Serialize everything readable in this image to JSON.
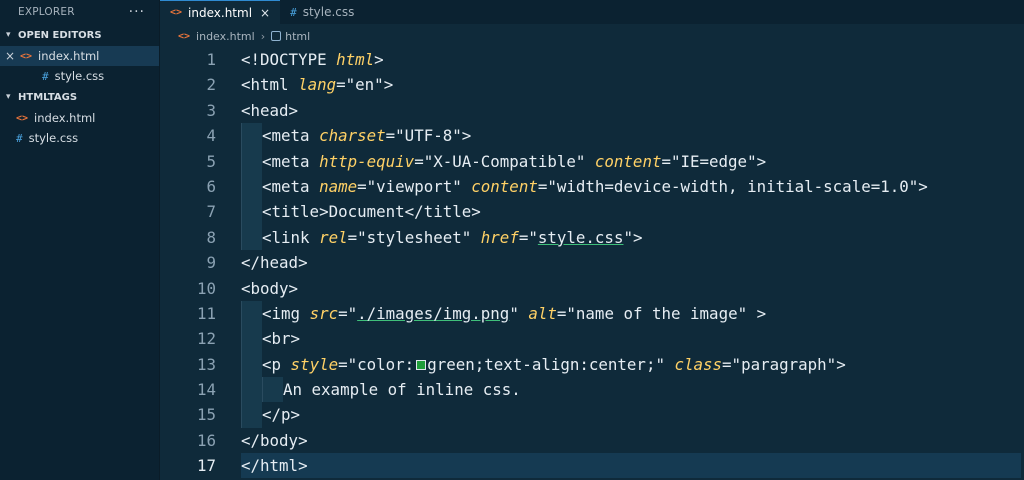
{
  "sidebar": {
    "title": "EXPLORER",
    "more": "···",
    "sections": [
      {
        "label": "OPEN EDITORS"
      },
      {
        "label": "HTMLTAGS"
      }
    ],
    "open_editors": [
      {
        "name": "index.html",
        "icon": "<>"
      },
      {
        "name": "style.css",
        "icon": "#"
      }
    ],
    "files": [
      {
        "name": "index.html",
        "icon": "<>"
      },
      {
        "name": "style.css",
        "icon": "#"
      }
    ]
  },
  "tabs": [
    {
      "label": "index.html",
      "icon": "<>",
      "close": "×"
    },
    {
      "label": "style.css",
      "icon": "#"
    }
  ],
  "breadcrumb": {
    "file": "index.html",
    "item": "html",
    "file_icon": "<>"
  },
  "editor": {
    "line_numbers": [
      "1",
      "2",
      "3",
      "4",
      "5",
      "6",
      "7",
      "8",
      "9",
      "10",
      "11",
      "12",
      "13",
      "14",
      "15",
      "16",
      "17"
    ],
    "code": {
      "l1": {
        "open": "<!DOCTYPE ",
        "kw": "html",
        "close": ">"
      },
      "l2": {
        "open": "<html ",
        "a1": "lang",
        "v1": "=\"en\"",
        "close": ">"
      },
      "l3": {
        "text": "<head>"
      },
      "l4": {
        "open": "<meta ",
        "a1": "charset",
        "v1": "=\"UTF-8\"",
        "close": ">"
      },
      "l5": {
        "open": "<meta ",
        "a1": "http-equiv",
        "v1": "=\"X-UA-Compatible\" ",
        "a2": "content",
        "v2": "=\"IE=edge\"",
        "close": ">"
      },
      "l6": {
        "open": "<meta ",
        "a1": "name",
        "v1": "=\"viewport\" ",
        "a2": "content",
        "v2": "=\"width=device-width, initial-scale=1.0\"",
        "close": ">"
      },
      "l7": {
        "text": "<title>Document</title>"
      },
      "l8": {
        "open": "<link ",
        "a1": "rel",
        "v1": "=\"stylesheet\" ",
        "a2": "href",
        "v2a": "=\"",
        "link": "style.css",
        "v2b": "\"",
        "close": ">"
      },
      "l9": {
        "text": "</head>"
      },
      "l10": {
        "text": "<body>"
      },
      "l11": {
        "open": "<img ",
        "a1": "src",
        "v1a": "=\"",
        "link": "./images/img.png",
        "v1b": "\" ",
        "a2": "alt",
        "v2": "=\"name of the image\" ",
        "close": ">"
      },
      "l12": {
        "text": "<br>"
      },
      "l13": {
        "open": "<p ",
        "a1": "style",
        "v1a": "=\"color:",
        "v1b": "green;text-align:center;\" ",
        "a2": "class",
        "v2": "=\"paragraph\"",
        "close": ">"
      },
      "l14": {
        "text": "An example of inline css."
      },
      "l15": {
        "text": "</p>"
      },
      "l16": {
        "text": "</body>"
      },
      "l17": {
        "text": "</html>"
      }
    },
    "swatch_color": "#1f9d3a"
  }
}
